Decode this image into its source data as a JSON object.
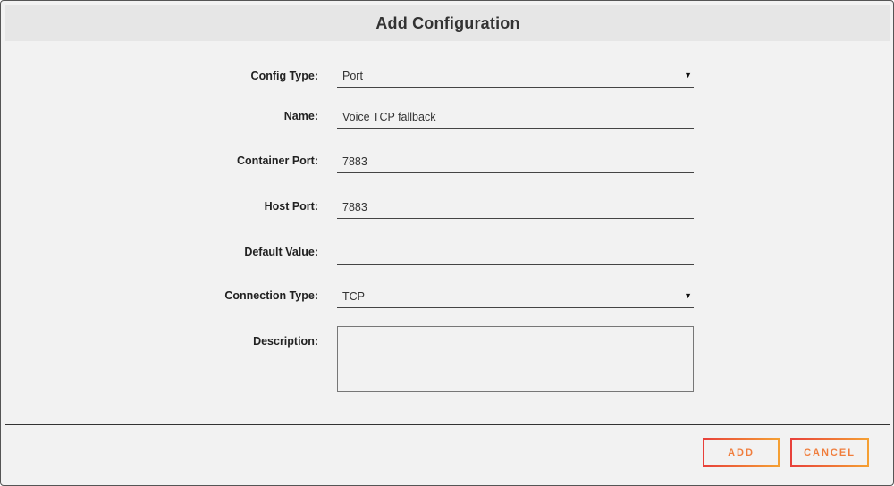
{
  "dialog": {
    "title": "Add Configuration"
  },
  "form": {
    "config_type": {
      "label": "Config Type:",
      "value": "Port",
      "arrow": "▼"
    },
    "name": {
      "label": "Name:",
      "value": "Voice TCP fallback"
    },
    "container_port": {
      "label": "Container Port:",
      "value": "7883"
    },
    "host_port": {
      "label": "Host Port:",
      "value": "7883"
    },
    "default_value": {
      "label": "Default Value:",
      "value": ""
    },
    "connection_type": {
      "label": "Connection Type:",
      "value": "TCP",
      "arrow": "▼"
    },
    "description": {
      "label": "Description:",
      "value": ""
    }
  },
  "footer": {
    "add_label": "ADD",
    "cancel_label": "CANCEL"
  },
  "colors": {
    "button_gradient_start": "#e8403a",
    "button_gradient_end": "#f5a033",
    "button_text": "#f07d3c"
  }
}
